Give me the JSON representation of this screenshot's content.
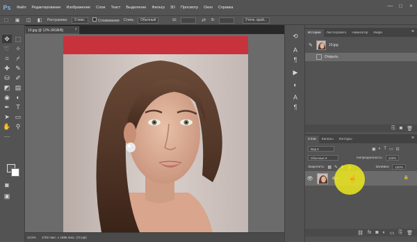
{
  "app": {
    "logo": "Ps"
  },
  "menu": [
    "Файл",
    "Редактирование",
    "Изображение",
    "Слои",
    "Текст",
    "Выделение",
    "Фильтр",
    "3D",
    "Просмотр",
    "Окно",
    "Справка"
  ],
  "window_controls": {
    "minimize": "—",
    "maximize": "□",
    "close": "×"
  },
  "options": {
    "feather_label": "Растушевка:",
    "feather_value": "0 пикс.",
    "antialias_label": "Сглаживание",
    "style_label": "Стиль",
    "style_value": "Обычный",
    "select_mask": "Уточн. край..."
  },
  "document": {
    "tab_title": "10.jpg @ 12% (RGB/8)",
    "tab_close": "×",
    "zoom": "12,5%",
    "info": "1792 пикс. x 1886 пикс. (72 ppi)"
  },
  "history_panel": {
    "tabs": [
      "История",
      "Листогр/авто",
      "Навигатор",
      "Инфо"
    ],
    "snapshot_label": "10.jpg",
    "items": [
      "Открыть"
    ]
  },
  "layers_panel": {
    "tabs": [
      "Слои",
      "Каналы",
      "Контуры"
    ],
    "filter_label": "Вид",
    "blend_mode": "Обычные",
    "opacity_label": "Непрозрачность:",
    "opacity_value": "100%",
    "lock_label": "Закрепить:",
    "fill_label": "Заливка:",
    "fill_value": "100%",
    "layer_name": "Фон"
  },
  "colors": {
    "ui_panel": "#535353",
    "ui_dark": "#282828",
    "canvas_bg": "#6b6b6b",
    "highlight": "#ece81e",
    "ps_blue": "#7fb2f0"
  },
  "icons": {
    "tools": [
      "move-icon",
      "marquee-icon",
      "lasso-icon",
      "magic-wand-icon",
      "crop-icon",
      "eyedropper-icon",
      "healing-icon",
      "brush-icon",
      "stamp-icon",
      "history-brush-icon",
      "eraser-icon",
      "gradient-icon",
      "blur-icon",
      "dodge-icon",
      "pen-icon",
      "type-icon",
      "path-select-icon",
      "rectangle-icon",
      "hand-icon",
      "zoom-icon"
    ]
  }
}
